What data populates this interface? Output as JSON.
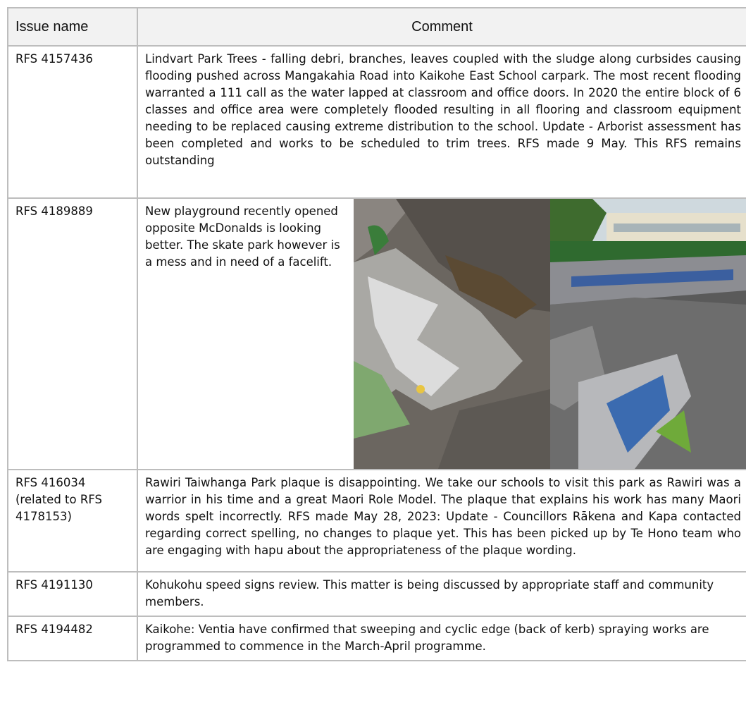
{
  "table": {
    "headers": {
      "issue": "Issue name",
      "comment": "Comment"
    },
    "rows": [
      {
        "issue": "RFS 4157436",
        "comment": "Lindvart Park Trees - falling debri, branches, leaves coupled with the sludge along curbsides causing flooding pushed across Mangakahia Road into Kaikohe East School carpark. The most recent flooding warranted a 111 call as the water lapped at classroom and office doors.  In 2020 the entire block of 6 classes and office area were completely flooded resulting in all flooring and classroom equipment needing to be replaced causing extreme distribution to the school. Update - Arborist assessment has been completed and works to be scheduled to trim trees. RFS made 9 May. This RFS remains outstanding"
      },
      {
        "issue": "RFS 4189889",
        "comment": "New playground recently opened opposite McDonalds is looking better. The skate park however is a mess and in need of a facelift."
      },
      {
        "issue": "RFS 416034 (related to RFS 4178153)",
        "comment": "Rawiri Taiwhanga Park plaque is disappointing.  We take our schools to visit this park as Rawiri was a warrior in his time and a great Maori Role Model. The plaque that explains his work has many Maori words spelt incorrectly.  RFS made May 28, 2023: Update - Councillors Rākena and Kapa contacted regarding correct spelling, no changes to plaque yet.  This has been picked up by Te Hono team who are engaging with hapu about the appropriateness of the plaque wording."
      },
      {
        "issue": "RFS 4191130",
        "comment": "Kohukohu speed signs review. This matter is being discussed by appropriate staff and community members."
      },
      {
        "issue": "RFS 4194482",
        "comment": "Kaikohe: Ventia have confirmed that sweeping and cyclic edge (back of kerb) spraying works are programmed to commence in the March-April programme."
      }
    ]
  }
}
